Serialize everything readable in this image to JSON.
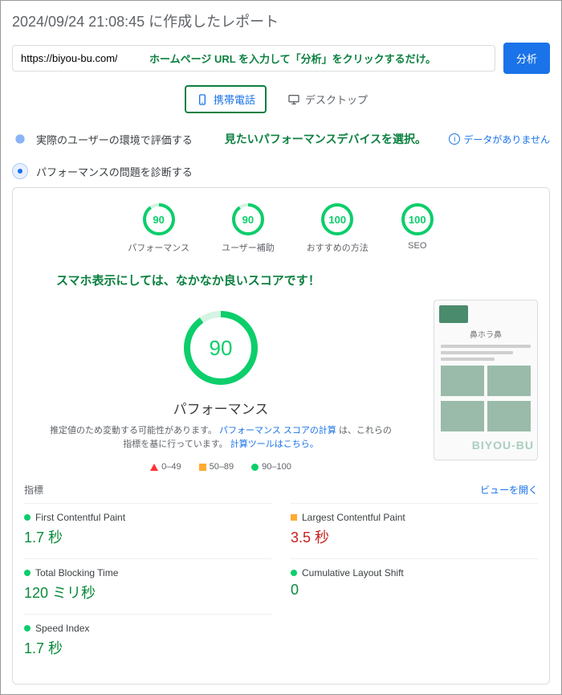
{
  "title": "2024/09/24 21:08:45 に作成したレポート",
  "url_input": {
    "value": "https://biyou-bu.com/",
    "annotation": "ホームページ URL を入力して「分析」をクリックするだけ。"
  },
  "analyze_btn": "分析",
  "tabs": {
    "mobile": "携帯電話",
    "desktop": "デスクトップ"
  },
  "sections": {
    "real_user": "実際のユーザーの環境で評価する",
    "device_annotation": "見たいパフォーマンスデバイスを選択。",
    "no_data": "データがありません",
    "diagnose": "パフォーマンスの問題を診断する"
  },
  "chart_data": {
    "type": "gauge",
    "scores": [
      {
        "label": "パフォーマンス",
        "value": 90
      },
      {
        "label": "ユーザー補助",
        "value": 90
      },
      {
        "label": "おすすめの方法",
        "value": 100
      },
      {
        "label": "SEO",
        "value": 100
      }
    ],
    "main_score": {
      "label": "パフォーマンス",
      "value": 90
    },
    "legend_ranges": [
      {
        "label": "0–49",
        "shape": "triangle",
        "color": "#ff3333"
      },
      {
        "label": "50–89",
        "shape": "square",
        "color": "#ffaa33"
      },
      {
        "label": "90–100",
        "shape": "circle",
        "color": "#0cce6b"
      }
    ]
  },
  "smartphone_annotation": "スマホ表示にしては、なかなか良いスコアです！",
  "performance_note": {
    "text1": "推定値のため変動する可能性があります。",
    "link1": "パフォーマンス スコアの計算",
    "text2": "は、これらの指標を基に行っています。",
    "link2": "計算ツールはこちら。"
  },
  "preview": {
    "brand_text": "鼻ホラ鼻",
    "watermark": "BIYOU-BU"
  },
  "metrics_header": {
    "label": "指標",
    "expand": "ビューを開く"
  },
  "metrics": [
    {
      "name": "First Contentful Paint",
      "value": "1.7 秒",
      "status": "good"
    },
    {
      "name": "Largest Contentful Paint",
      "value": "3.5 秒",
      "status": "warn"
    },
    {
      "name": "Total Blocking Time",
      "value": "120 ミリ秒",
      "status": "good"
    },
    {
      "name": "Cumulative Layout Shift",
      "value": "0",
      "status": "good"
    },
    {
      "name": "Speed Index",
      "value": "1.7 秒",
      "status": "good"
    }
  ]
}
